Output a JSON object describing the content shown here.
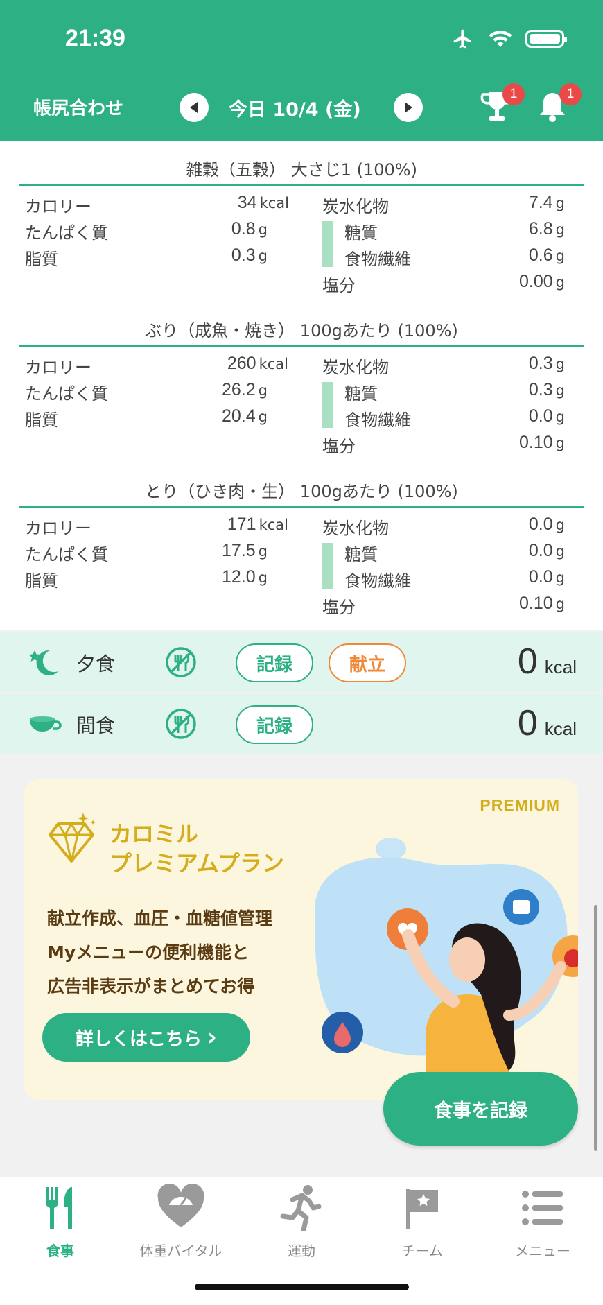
{
  "status_bar": {
    "time": "21:39"
  },
  "header": {
    "title": "帳尻合わせ",
    "date_label": "今日 10/4 (金)",
    "trophy_badge": "1",
    "bell_badge": "1",
    "accent_color": "#2eb085"
  },
  "foods": [
    {
      "title": "雑穀（五穀） 大さじ1 (100%)",
      "calorie_label": "カロリー",
      "calorie_value": "34",
      "calorie_unit": "kcal",
      "protein_label": "たんぱく質",
      "protein_value": "0.8",
      "protein_unit": "g",
      "fat_label": "脂質",
      "fat_value": "0.3",
      "fat_unit": "g",
      "carb_label": "炭水化物",
      "carb_value": "7.4",
      "carb_unit": "g",
      "sugar_label": "糖質",
      "sugar_value": "6.8",
      "sugar_unit": "g",
      "fiber_label": "食物繊維",
      "fiber_value": "0.6",
      "fiber_unit": "g",
      "salt_label": "塩分",
      "salt_value": "0.00",
      "salt_unit": "g"
    },
    {
      "title": "ぶり（成魚・焼き） 100gあたり (100%)",
      "calorie_label": "カロリー",
      "calorie_value": "260",
      "calorie_unit": "kcal",
      "protein_label": "たんぱく質",
      "protein_value": "26.2",
      "protein_unit": "g",
      "fat_label": "脂質",
      "fat_value": "20.4",
      "fat_unit": "g",
      "carb_label": "炭水化物",
      "carb_value": "0.3",
      "carb_unit": "g",
      "sugar_label": "糖質",
      "sugar_value": "0.3",
      "sugar_unit": "g",
      "fiber_label": "食物繊維",
      "fiber_value": "0.0",
      "fiber_unit": "g",
      "salt_label": "塩分",
      "salt_value": "0.10",
      "salt_unit": "g"
    },
    {
      "title": "とり（ひき肉・生） 100gあたり (100%)",
      "calorie_label": "カロリー",
      "calorie_value": "171",
      "calorie_unit": "kcal",
      "protein_label": "たんぱく質",
      "protein_value": "17.5",
      "protein_unit": "g",
      "fat_label": "脂質",
      "fat_value": "12.0",
      "fat_unit": "g",
      "carb_label": "炭水化物",
      "carb_value": "0.0",
      "carb_unit": "g",
      "sugar_label": "糖質",
      "sugar_value": "0.0",
      "sugar_unit": "g",
      "fiber_label": "食物繊維",
      "fiber_value": "0.0",
      "fiber_unit": "g",
      "salt_label": "塩分",
      "salt_value": "0.10",
      "salt_unit": "g"
    }
  ],
  "meals": {
    "dinner": {
      "label": "夕食",
      "record_label": "記録",
      "menu_label": "献立",
      "kcal": "0",
      "kcal_unit": "kcal",
      "icon": "moon-star-icon"
    },
    "snack": {
      "label": "間食",
      "record_label": "記録",
      "kcal": "0",
      "kcal_unit": "kcal",
      "icon": "coffee-cup-icon"
    }
  },
  "banner": {
    "badge": "PREMIUM",
    "title_line1": "カロミル",
    "title_line2": "プレミアムプラン",
    "desc_line1": "献立作成、血圧・血糖値管理",
    "desc_line2": "Myメニューの便利機能と",
    "desc_line3": "広告非表示がまとめてお得",
    "cta": "詳しくはこちら",
    "cta_arrow": "›",
    "gold_color": "#d4ad1d"
  },
  "fab": {
    "label": "食事を記録"
  },
  "tabs": [
    {
      "label": "食事",
      "icon": "fork-knife-icon",
      "active": true
    },
    {
      "label": "体重バイタル",
      "icon": "heart-scale-icon",
      "active": false
    },
    {
      "label": "運動",
      "icon": "running-person-icon",
      "active": false
    },
    {
      "label": "チーム",
      "icon": "flag-icon",
      "active": false
    },
    {
      "label": "メニュー",
      "icon": "menu-list-icon",
      "active": false
    }
  ]
}
